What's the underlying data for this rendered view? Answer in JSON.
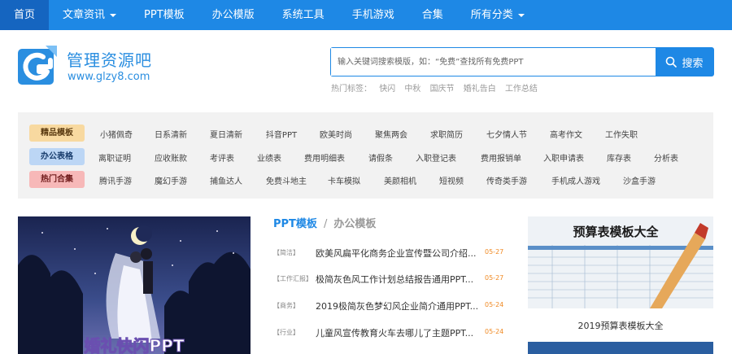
{
  "nav": {
    "items": [
      {
        "label": "首页",
        "active": true,
        "dropdown": false
      },
      {
        "label": "文章资讯",
        "active": false,
        "dropdown": true
      },
      {
        "label": "PPT模板",
        "active": false,
        "dropdown": false
      },
      {
        "label": "办公模版",
        "active": false,
        "dropdown": false
      },
      {
        "label": "系统工具",
        "active": false,
        "dropdown": false
      },
      {
        "label": "手机游戏",
        "active": false,
        "dropdown": false
      },
      {
        "label": "合集",
        "active": false,
        "dropdown": false
      },
      {
        "label": "所有分类",
        "active": false,
        "dropdown": true
      }
    ]
  },
  "logo": {
    "name": "管理资源吧",
    "url": "www.glzy8.com"
  },
  "search": {
    "placeholder": "输入关键词搜索模版，如：“免费”查找所有免费PPT",
    "button_label": "搜索",
    "hot_label": "热门标签：",
    "hot_words": [
      "快闪",
      "中秋",
      "国庆节",
      "婚礼告白",
      "工作总结"
    ]
  },
  "categories": [
    {
      "tag": "精品模板",
      "items": [
        "小猪佩奇",
        "日系清新",
        "夏日清新",
        "抖音PPT",
        "欧美时尚",
        "聚焦两会",
        "求职简历",
        "七夕情人节",
        "高考作文",
        "工作失职"
      ]
    },
    {
      "tag": "办公表格",
      "items": [
        "离职证明",
        "应收账款",
        "考评表",
        "业绩表",
        "费用明细表",
        "请假条",
        "入职登记表",
        "费用报销单",
        "入职申请表",
        "库存表",
        "分析表"
      ]
    },
    {
      "tag": "热门合集",
      "items": [
        "腾讯手游",
        "魔幻手游",
        "捕鱼达人",
        "免费斗地主",
        "卡车模拟",
        "美颜相机",
        "短视频",
        "传奇类手游",
        "手机成人游戏",
        "沙盒手游"
      ]
    }
  ],
  "banner": {
    "text": "婚礼快闪PPT"
  },
  "tabs": {
    "active": "PPT模板",
    "separator": "/",
    "other": "办公模板"
  },
  "articles": [
    {
      "category": "【简洁】",
      "title": "欧美风扁平化商务企业宣传暨公司介绍...",
      "date": "05-27"
    },
    {
      "category": "【工作汇报】",
      "title": "极简灰色风工作计划总结报告通用PPT...",
      "date": "05-27"
    },
    {
      "category": "【商务】",
      "title": "2019极简灰色梦幻风企业简介通用PPT...",
      "date": "05-24"
    },
    {
      "category": "【行业】",
      "title": "儿童风宣传教育火车去哪儿了主题PPT...",
      "date": "05-24"
    }
  ],
  "feature": {
    "image_text": "预算表模板大全",
    "caption": "2019预算表模板大全"
  },
  "colors": {
    "primary": "#1e88e5",
    "nav_active": "#1565c0",
    "date": "#f08a24"
  }
}
